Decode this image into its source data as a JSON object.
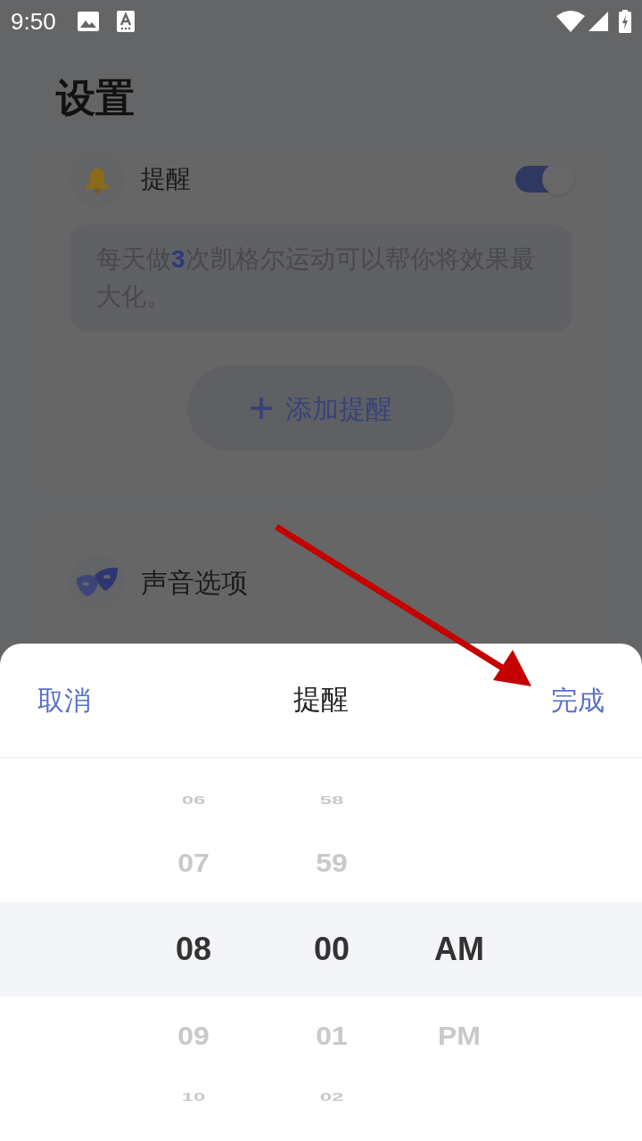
{
  "status_bar": {
    "time": "9:50"
  },
  "header": {
    "title": "设置"
  },
  "reminder_card": {
    "title": "提醒",
    "on": true,
    "tip": "每天做**3**次凯格尔运动可以帮你将效果最大化。",
    "add_button": "添加提醒"
  },
  "sound_card": {
    "title": "声音选项"
  },
  "sheet": {
    "cancel": "取消",
    "title": "提醒",
    "done": "完成",
    "columns": [
      {
        "items": [
          {
            "label": "06",
            "selected": false
          },
          {
            "label": "07",
            "selected": false
          },
          {
            "label": "08",
            "selected": true
          },
          {
            "label": "09",
            "selected": false
          },
          {
            "label": "10",
            "selected": false
          }
        ]
      },
      {
        "items": [
          {
            "label": "58",
            "selected": false
          },
          {
            "label": "59",
            "selected": false
          },
          {
            "label": "00",
            "selected": true
          },
          {
            "label": "01",
            "selected": false
          },
          {
            "label": "02",
            "selected": false
          }
        ]
      },
      {
        "items": [
          {
            "label": "AM",
            "selected": true
          },
          {
            "label": "PM",
            "selected": false
          }
        ]
      }
    ]
  }
}
